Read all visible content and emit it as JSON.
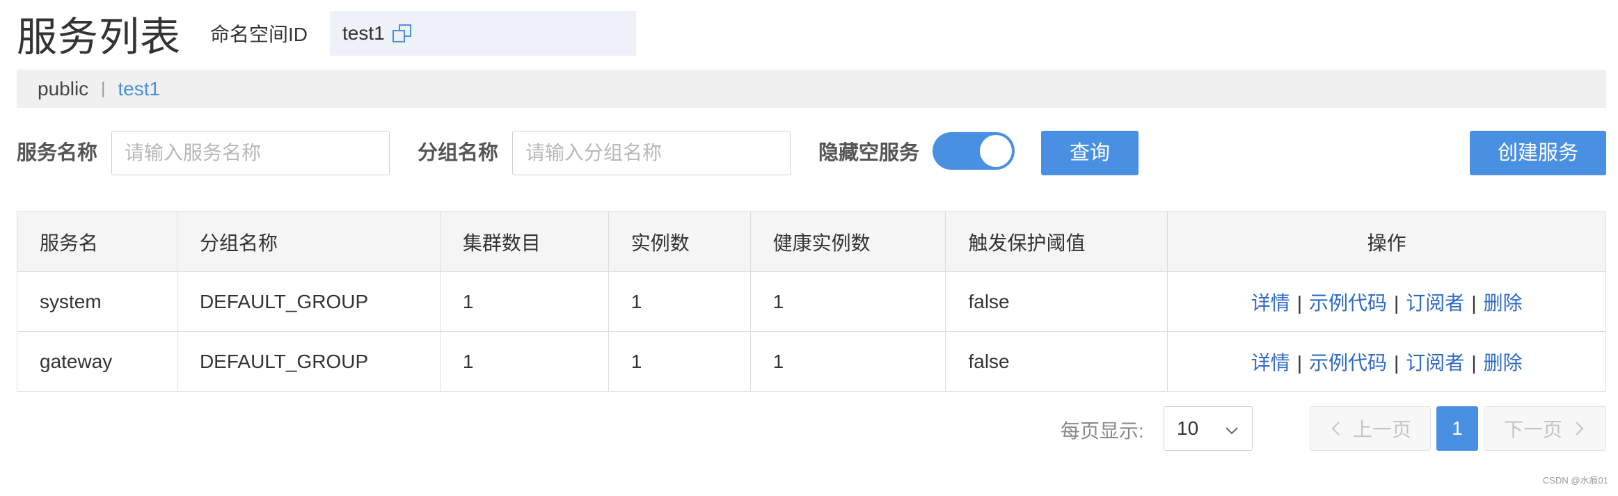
{
  "header": {
    "title": "服务列表",
    "namespace_label": "命名空间ID",
    "namespace_value": "test1"
  },
  "namespaces": {
    "items": [
      "public",
      "test1"
    ],
    "separator": "|",
    "active": "test1"
  },
  "filters": {
    "service_label": "服务名称",
    "service_placeholder": "请输入服务名称",
    "group_label": "分组名称",
    "group_placeholder": "请输入分组名称",
    "hide_empty_label": "隐藏空服务",
    "hide_empty_on": true,
    "query_button": "查询",
    "create_button": "创建服务"
  },
  "table": {
    "columns": [
      "服务名",
      "分组名称",
      "集群数目",
      "实例数",
      "健康实例数",
      "触发保护阈值",
      "操作"
    ],
    "rows": [
      {
        "name": "system",
        "group": "DEFAULT_GROUP",
        "clusters": "1",
        "instances": "1",
        "healthy": "1",
        "protect": "false"
      },
      {
        "name": "gateway",
        "group": "DEFAULT_GROUP",
        "clusters": "1",
        "instances": "1",
        "healthy": "1",
        "protect": "false"
      }
    ],
    "actions": [
      "详情",
      "示例代码",
      "订阅者",
      "删除"
    ],
    "action_separator": "|"
  },
  "pagination": {
    "per_page_label": "每页显示:",
    "per_page_value": "10",
    "prev": "上一页",
    "current": "1",
    "next": "下一页"
  },
  "watermark": "CSDN @水痕01",
  "colors": {
    "primary": "#4a90e2",
    "link": "#2f6ac4",
    "ns_bar": "#f0f0f0",
    "table_header": "#f5f5f5"
  }
}
